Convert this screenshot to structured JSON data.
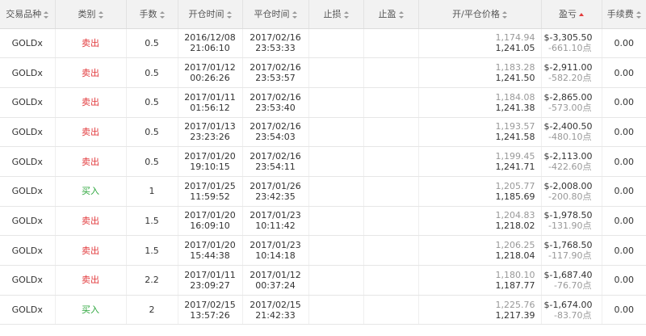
{
  "header": [
    {
      "label": "交易品种",
      "sort": "both"
    },
    {
      "label": "类别",
      "sort": "both"
    },
    {
      "label": "手数",
      "sort": "both"
    },
    {
      "label": "开仓时间",
      "sort": "both"
    },
    {
      "label": "平仓时间",
      "sort": "both"
    },
    {
      "label": "止损",
      "sort": "both"
    },
    {
      "label": "止盈",
      "sort": "both"
    },
    {
      "label": "开/平仓价格",
      "sort": "both"
    },
    {
      "label": "盈亏",
      "sort": "asc-active"
    },
    {
      "label": "手续费",
      "sort": "both"
    }
  ],
  "colors": {
    "sell": "#e2393c",
    "buy": "#2aa53a",
    "header_bg": "#f2f2f2",
    "active_sort": "#e23b3b"
  },
  "rows": [
    {
      "symbol": "GOLDx",
      "type": "卖出",
      "type_kind": "sell",
      "lots": "0.5",
      "open_date": "2016/12/08",
      "open_time": "21:06:10",
      "close_date": "2017/02/16",
      "close_time": "23:53:33",
      "sl": "",
      "tp": "",
      "open_price": "1,174.94",
      "close_price": "1,241.05",
      "profit": "$-3,305.50",
      "points": "-661.10点",
      "fee": "0.00"
    },
    {
      "symbol": "GOLDx",
      "type": "卖出",
      "type_kind": "sell",
      "lots": "0.5",
      "open_date": "2017/01/12",
      "open_time": "00:26:26",
      "close_date": "2017/02/16",
      "close_time": "23:53:57",
      "sl": "",
      "tp": "",
      "open_price": "1,183.28",
      "close_price": "1,241.50",
      "profit": "$-2,911.00",
      "points": "-582.20点",
      "fee": "0.00"
    },
    {
      "symbol": "GOLDx",
      "type": "卖出",
      "type_kind": "sell",
      "lots": "0.5",
      "open_date": "2017/01/11",
      "open_time": "01:56:12",
      "close_date": "2017/02/16",
      "close_time": "23:53:40",
      "sl": "",
      "tp": "",
      "open_price": "1,184.08",
      "close_price": "1,241.38",
      "profit": "$-2,865.00",
      "points": "-573.00点",
      "fee": "0.00"
    },
    {
      "symbol": "GOLDx",
      "type": "卖出",
      "type_kind": "sell",
      "lots": "0.5",
      "open_date": "2017/01/13",
      "open_time": "23:23:26",
      "close_date": "2017/02/16",
      "close_time": "23:54:03",
      "sl": "",
      "tp": "",
      "open_price": "1,193.57",
      "close_price": "1,241.58",
      "profit": "$-2,400.50",
      "points": "-480.10点",
      "fee": "0.00"
    },
    {
      "symbol": "GOLDx",
      "type": "卖出",
      "type_kind": "sell",
      "lots": "0.5",
      "open_date": "2017/01/20",
      "open_time": "19:10:15",
      "close_date": "2017/02/16",
      "close_time": "23:54:11",
      "sl": "",
      "tp": "",
      "open_price": "1,199.45",
      "close_price": "1,241.71",
      "profit": "$-2,113.00",
      "points": "-422.60点",
      "fee": "0.00"
    },
    {
      "symbol": "GOLDx",
      "type": "买入",
      "type_kind": "buy",
      "lots": "1",
      "open_date": "2017/01/25",
      "open_time": "11:59:52",
      "close_date": "2017/01/26",
      "close_time": "23:42:35",
      "sl": "",
      "tp": "",
      "open_price": "1,205.77",
      "close_price": "1,185.69",
      "profit": "$-2,008.00",
      "points": "-200.80点",
      "fee": "0.00"
    },
    {
      "symbol": "GOLDx",
      "type": "卖出",
      "type_kind": "sell",
      "lots": "1.5",
      "open_date": "2017/01/20",
      "open_time": "16:09:10",
      "close_date": "2017/01/23",
      "close_time": "10:11:42",
      "sl": "",
      "tp": "",
      "open_price": "1,204.83",
      "close_price": "1,218.02",
      "profit": "$-1,978.50",
      "points": "-131.90点",
      "fee": "0.00"
    },
    {
      "symbol": "GOLDx",
      "type": "卖出",
      "type_kind": "sell",
      "lots": "1.5",
      "open_date": "2017/01/20",
      "open_time": "15:44:38",
      "close_date": "2017/01/23",
      "close_time": "10:14:18",
      "sl": "",
      "tp": "",
      "open_price": "1,206.25",
      "close_price": "1,218.04",
      "profit": "$-1,768.50",
      "points": "-117.90点",
      "fee": "0.00"
    },
    {
      "symbol": "GOLDx",
      "type": "卖出",
      "type_kind": "sell",
      "lots": "2.2",
      "open_date": "2017/01/11",
      "open_time": "23:09:27",
      "close_date": "2017/01/12",
      "close_time": "00:37:24",
      "sl": "",
      "tp": "",
      "open_price": "1,180.10",
      "close_price": "1,187.77",
      "profit": "$-1,687.40",
      "points": "-76.70点",
      "fee": "0.00"
    },
    {
      "symbol": "GOLDx",
      "type": "买入",
      "type_kind": "buy",
      "lots": "2",
      "open_date": "2017/02/15",
      "open_time": "13:57:26",
      "close_date": "2017/02/15",
      "close_time": "21:42:33",
      "sl": "",
      "tp": "",
      "open_price": "1,225.76",
      "close_price": "1,217.39",
      "profit": "$-1,674.00",
      "points": "-83.70点",
      "fee": "0.00"
    }
  ]
}
